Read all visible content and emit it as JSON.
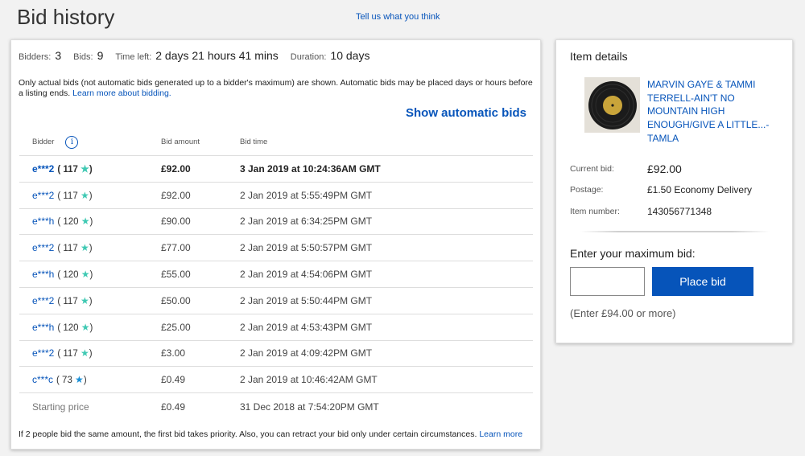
{
  "header": {
    "title": "Bid history",
    "feedback_link": "Tell us what you think"
  },
  "summary": {
    "bidders_label": "Bidders:",
    "bidders_value": "3",
    "bids_label": "Bids:",
    "bids_value": "9",
    "time_left_label": "Time left:",
    "time_left_value": "2 days 21 hours 41 mins",
    "duration_label": "Duration:",
    "duration_value": "10 days"
  },
  "note": {
    "text": "Only actual bids (not automatic bids generated up to a bidder's maximum) are shown. Automatic bids may be placed days or hours before a listing ends.",
    "link": "Learn more about bidding."
  },
  "show_automatic_bids": "Show automatic bids",
  "table": {
    "headers": {
      "bidder": "Bidder",
      "amount": "Bid amount",
      "time": "Bid time"
    },
    "rows": [
      {
        "bidder": "e***2",
        "feedback": "117",
        "star": "teal",
        "amount": "£92.00",
        "time": "3 Jan 2019 at 10:24:36AM GMT",
        "bold": true
      },
      {
        "bidder": "e***2",
        "feedback": "117",
        "star": "teal",
        "amount": "£92.00",
        "time": "2 Jan 2019 at 5:55:49PM GMT",
        "bold": false
      },
      {
        "bidder": "e***h",
        "feedback": "120",
        "star": "teal",
        "amount": "£90.00",
        "time": "2 Jan 2019 at 6:34:25PM GMT",
        "bold": false
      },
      {
        "bidder": "e***2",
        "feedback": "117",
        "star": "teal",
        "amount": "£77.00",
        "time": "2 Jan 2019 at 5:50:57PM GMT",
        "bold": false
      },
      {
        "bidder": "e***h",
        "feedback": "120",
        "star": "teal",
        "amount": "£55.00",
        "time": "2 Jan 2019 at 4:54:06PM GMT",
        "bold": false
      },
      {
        "bidder": "e***2",
        "feedback": "117",
        "star": "teal",
        "amount": "£50.00",
        "time": "2 Jan 2019 at 5:50:44PM GMT",
        "bold": false
      },
      {
        "bidder": "e***h",
        "feedback": "120",
        "star": "teal",
        "amount": "£25.00",
        "time": "2 Jan 2019 at 4:53:43PM GMT",
        "bold": false
      },
      {
        "bidder": "e***2",
        "feedback": "117",
        "star": "teal",
        "amount": "£3.00",
        "time": "2 Jan 2019 at 4:09:42PM GMT",
        "bold": false
      },
      {
        "bidder": "c***c",
        "feedback": "73",
        "star": "blue",
        "amount": "£0.49",
        "time": "2 Jan 2019 at 10:46:42AM GMT",
        "bold": false
      }
    ],
    "starting_row": {
      "label": "Starting price",
      "amount": "£0.49",
      "time": "31 Dec 2018 at 7:54:20PM GMT"
    }
  },
  "footer_note": {
    "text": "If 2 people bid the same amount, the first bid takes priority. Also, you can retract your bid only under certain circumstances.",
    "link": "Learn more"
  },
  "item_details": {
    "title": "Item details",
    "item_title": "MARVIN GAYE & TAMMI TERRELL-AIN'T NO MOUNTAIN HIGH ENOUGH/GIVE A LITTLE...-TAMLA",
    "current_bid_label": "Current bid:",
    "current_bid_value": "£92.00",
    "postage_label": "Postage:",
    "postage_value": "£1.50 Economy Delivery",
    "item_number_label": "Item number:",
    "item_number_value": "143056771348",
    "enter_max_bid_label": "Enter your maximum bid:",
    "bid_input_value": "",
    "place_bid_label": "Place bid",
    "min_bid_note": "(Enter £94.00 or more)"
  },
  "colors": {
    "link": "#0654ba",
    "star_teal": "#3fc9b3",
    "star_blue": "#1a8fd6",
    "button": "#0654ba"
  }
}
